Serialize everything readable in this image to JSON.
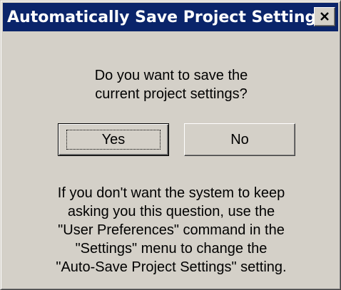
{
  "window": {
    "title": "Automatically Save Project Settings",
    "close_icon": "close-x-icon",
    "titlebar_color": "#0a246a",
    "face_color": "#d4d0c8"
  },
  "prompt": {
    "lines": [
      "Do you want to save the",
      "current project settings?"
    ]
  },
  "buttons": {
    "yes_label": "Yes",
    "no_label": "No"
  },
  "info": {
    "lines": [
      "If you don't want the system to keep",
      "asking you this question, use the",
      "\"User Preferences\" command in the",
      "\"Settings\" menu to change the",
      "\"Auto-Save Project Settings\" setting."
    ]
  }
}
